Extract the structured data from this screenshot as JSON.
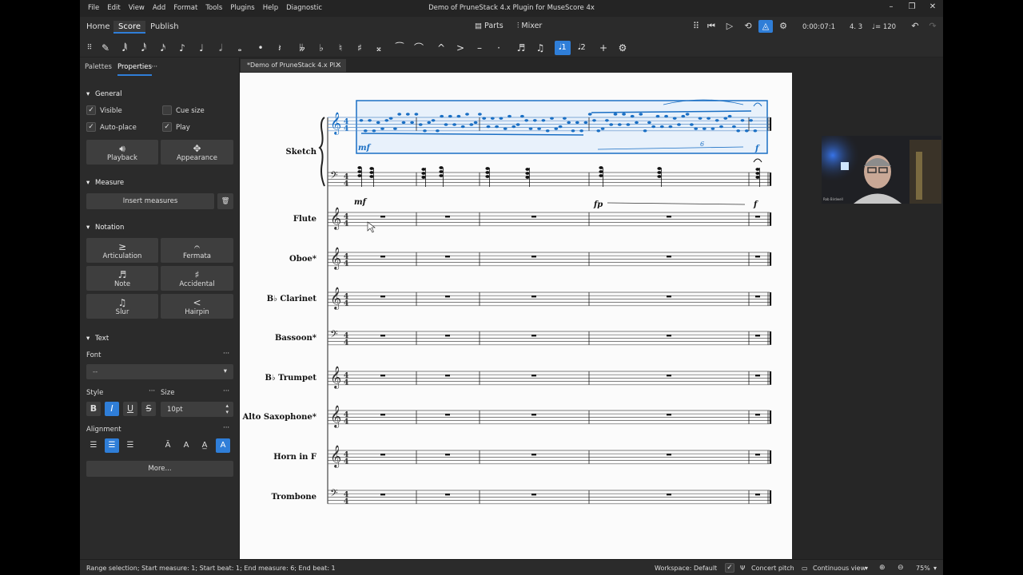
{
  "menu": [
    "File",
    "Edit",
    "View",
    "Add",
    "Format",
    "Tools",
    "Plugins",
    "Help",
    "Diagnostic"
  ],
  "window": {
    "title": "Demo of PruneStack 4.x Plugin for MuseScore 4x",
    "controls": [
      "–",
      "❐",
      "✕"
    ]
  },
  "tabs": {
    "home": "Home",
    "score": "Score",
    "publish": "Publish"
  },
  "top_buttons": {
    "parts": "Parts",
    "mixer": "Mixer"
  },
  "playback": {
    "time": "0:00:07:1",
    "position": "4. 3",
    "tempo": "♩= 120"
  },
  "note_toolbar": [
    "⠿",
    "✎",
    "𝅘𝅥𝅱",
    "𝅘𝅥𝅰",
    "𝅘𝅥𝅯",
    "♪",
    "♩",
    "𝅗𝅥",
    "𝅝",
    "•",
    "𝄽",
    "𝄫",
    "♭",
    "♮",
    "♯",
    "𝄪",
    "⁀",
    "⌒",
    "^",
    ">",
    "–",
    "·",
    "♬",
    "♫",
    "𝅘𝅥1",
    "𝅘𝅥2",
    "+",
    "⚙"
  ],
  "panel": {
    "tab_palettes": "Palettes",
    "tab_properties": "Properties",
    "more_dots": "···",
    "general": {
      "title": "General",
      "visible": "Visible",
      "cue_size": "Cue size",
      "auto_place": "Auto-place",
      "play": "Play",
      "playback": "Playback",
      "appearance": "Appearance"
    },
    "measure": {
      "title": "Measure",
      "insert": "Insert measures"
    },
    "notation": {
      "title": "Notation",
      "items": [
        "Articulation",
        "Fermata",
        "Note",
        "Accidental",
        "Slur",
        "Hairpin"
      ]
    },
    "text": {
      "title": "Text",
      "font_label": "Font",
      "font_value": "--",
      "style_label": "Style",
      "size_label": "Size",
      "size_value": "10pt",
      "alignment_label": "Alignment",
      "more": "More..."
    }
  },
  "document_tab": "*Demo of PruneStack 4.x Pl...",
  "score": {
    "instruments": [
      "Sketch",
      "Flute",
      "Oboe*",
      "B♭ Clarinet",
      "Bassoon*",
      "B♭ Trumpet",
      "Alto Saxophone*",
      "Horn in F",
      "Trombone"
    ],
    "dynamics": [
      "mf",
      "f",
      "mf",
      "fp",
      "f"
    ],
    "tuplet": "6",
    "time_signature": "4/4"
  },
  "status": {
    "selection": "Range selection; Start measure: 1; Start beat: 1; End measure: 6; End beat: 1",
    "workspace": "Workspace: Default",
    "concert_pitch": "Concert pitch",
    "view_mode": "Continuous view",
    "zoom": "75%"
  },
  "webcam": {
    "caption": "Rob Birdwell"
  },
  "colors": {
    "accent": "#2f7ed8",
    "selection": "#1a6fc4",
    "panel": "#2b2b2b",
    "page": "#fbfbfb"
  }
}
